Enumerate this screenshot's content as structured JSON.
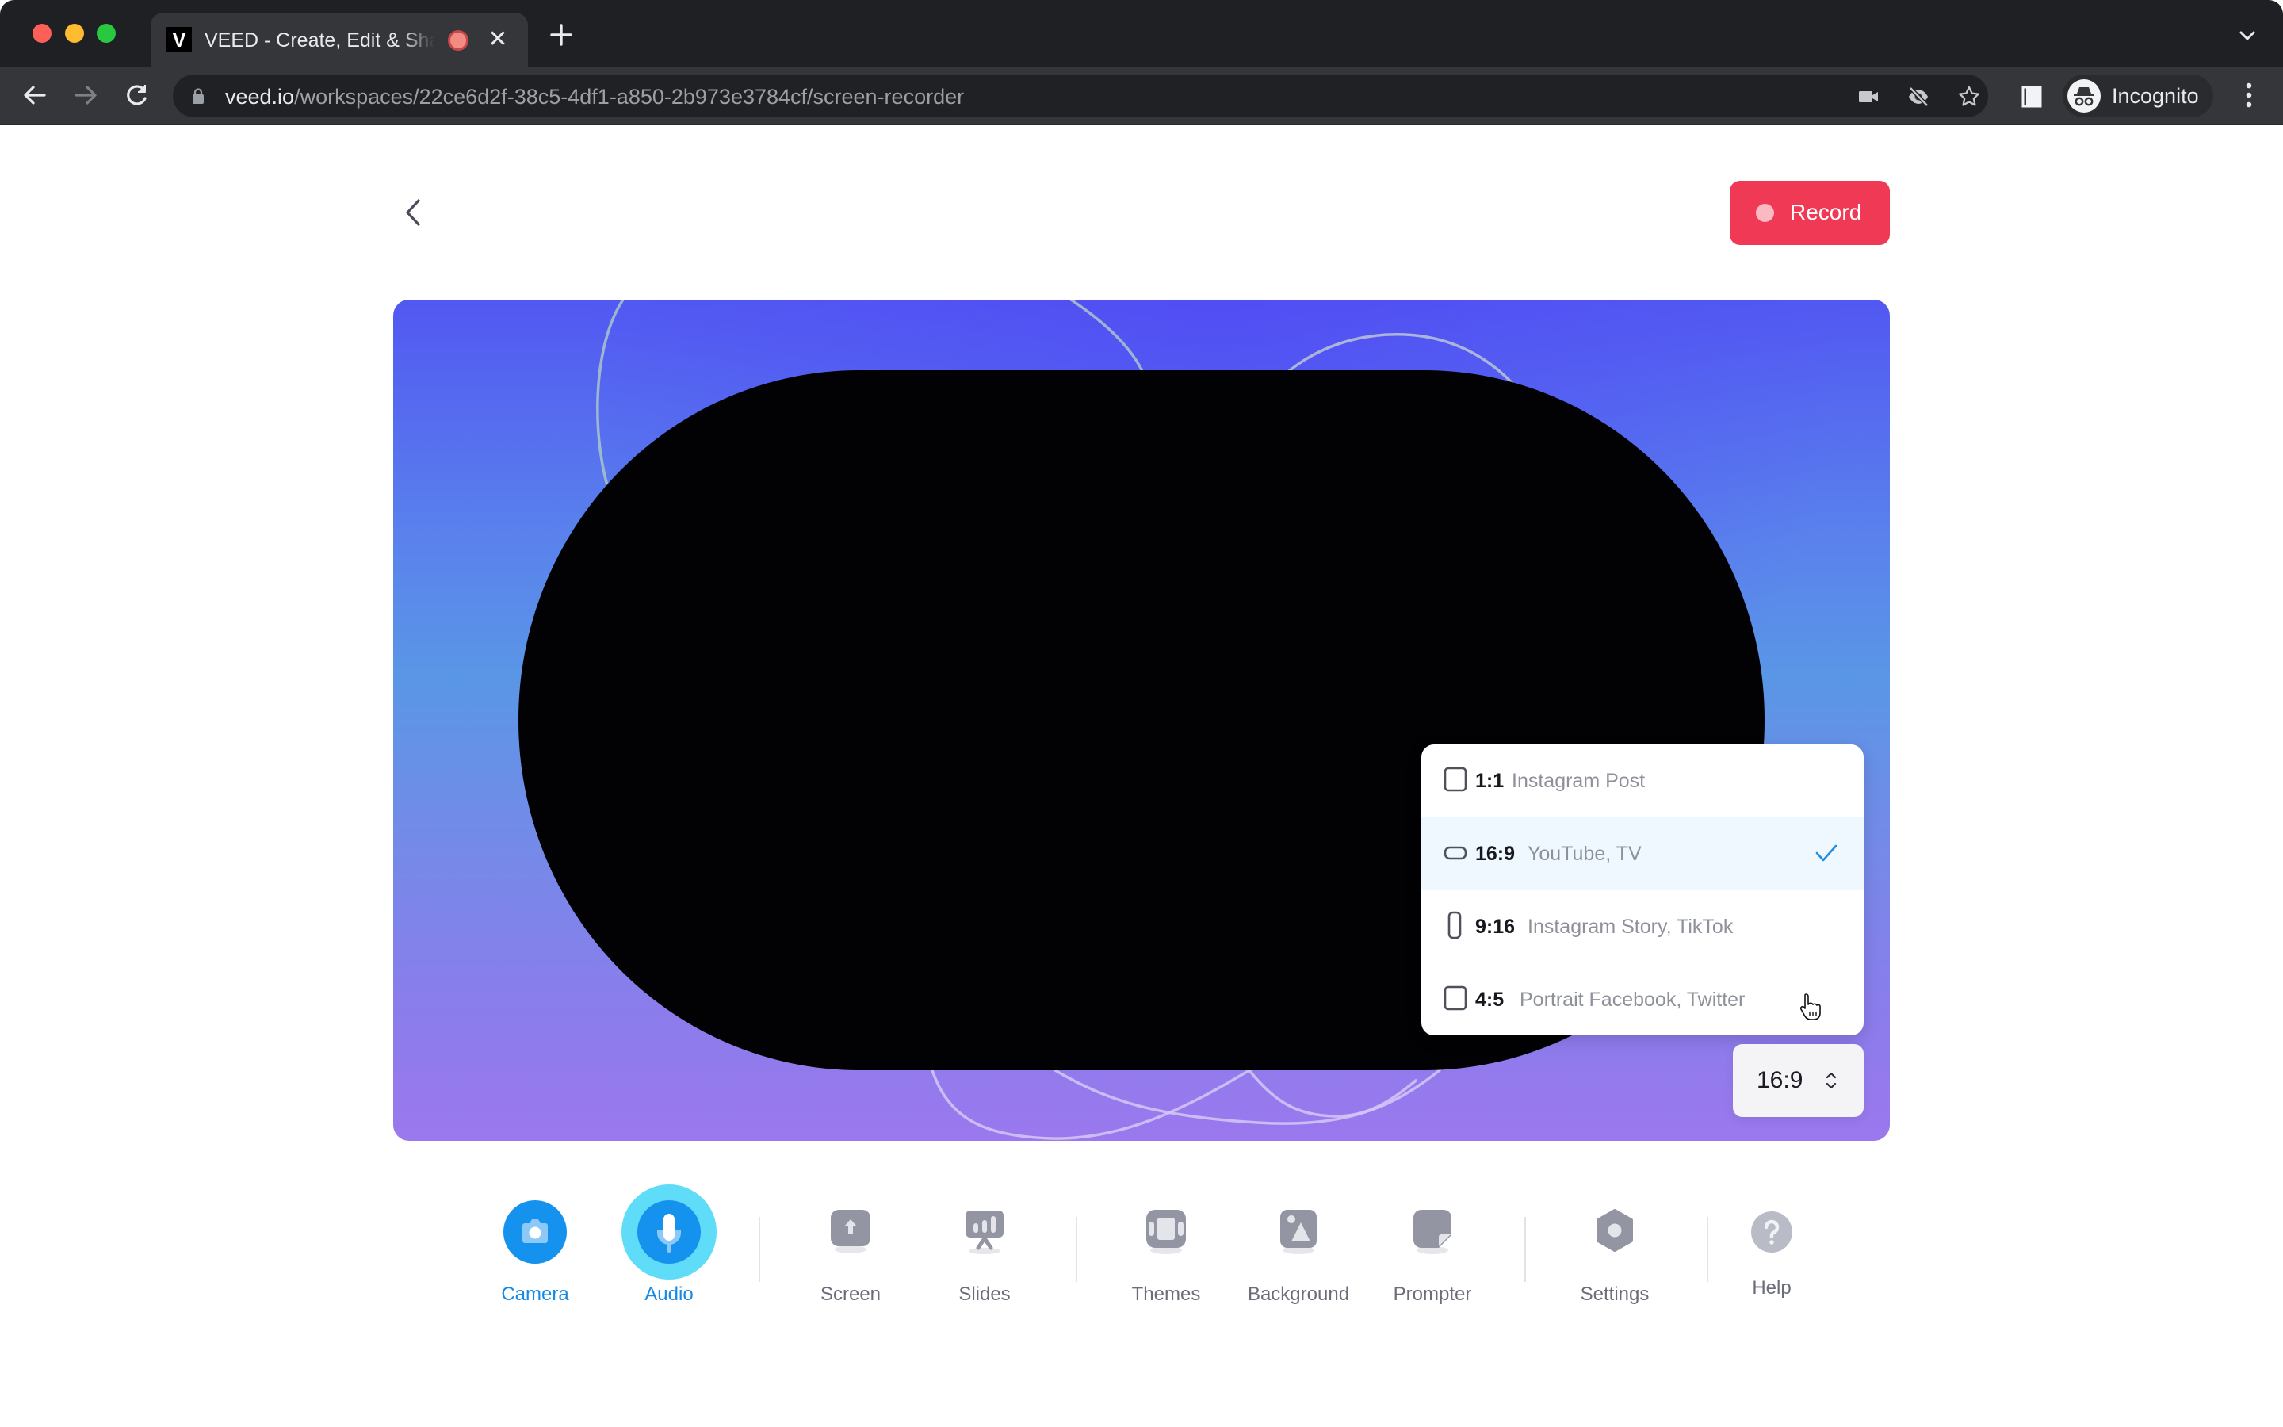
{
  "browser": {
    "tab": {
      "favicon_letter": "V",
      "title": "VEED - Create, Edit & Share Videos Online",
      "recording_indicator": "recording-icon",
      "close_icon": "close-icon"
    },
    "new_tab_icon": "plus-icon",
    "url": {
      "host": "veed.io",
      "path": "/workspaces/22ce6d2f-38c5-4df1-a850-2b973e3784cf/screen-recorder"
    },
    "omnibox_icons": [
      "camera-in-use-icon",
      "eye-off-icon",
      "star-icon"
    ],
    "profile_label": "Incognito",
    "colors": {
      "chrome_bg": "#1f2023",
      "tab_bg": "#35363a",
      "omnibox_bg": "#202124"
    }
  },
  "page": {
    "record_button": {
      "label": "Record",
      "color": "#f03a55"
    },
    "aspect_selector": {
      "current": "16:9",
      "options": [
        {
          "ratio": "1:1",
          "description": "Instagram Post",
          "icon": "square-icon",
          "selected": false
        },
        {
          "ratio": "16:9",
          "description": "YouTube, TV",
          "icon": "landscape-icon",
          "selected": true
        },
        {
          "ratio": "9:16",
          "description": "Instagram Story, TikTok",
          "icon": "portrait-icon",
          "selected": false
        },
        {
          "ratio": "4:5",
          "description": "Portrait Facebook, Twitter",
          "icon": "square-icon",
          "selected": false
        }
      ]
    },
    "toolbar": [
      {
        "id": "camera",
        "label": "Camera",
        "icon": "camera-icon",
        "active": true
      },
      {
        "id": "audio",
        "label": "Audio",
        "icon": "microphone-icon",
        "active": true
      },
      {
        "id": "screen",
        "label": "Screen",
        "icon": "screen-share-icon",
        "active": false
      },
      {
        "id": "slides",
        "label": "Slides",
        "icon": "slides-icon",
        "active": false
      },
      {
        "id": "themes",
        "label": "Themes",
        "icon": "themes-icon",
        "active": false
      },
      {
        "id": "background",
        "label": "Background",
        "icon": "background-icon",
        "active": false
      },
      {
        "id": "prompter",
        "label": "Prompter",
        "icon": "prompter-icon",
        "active": false
      },
      {
        "id": "settings",
        "label": "Settings",
        "icon": "settings-icon",
        "active": false
      },
      {
        "id": "help",
        "label": "Help",
        "icon": "help-icon",
        "active": false
      }
    ],
    "colors": {
      "accent": "#1589e6",
      "accent_ring": "#5ddcf6",
      "inactive_icon": "#9395a3",
      "selected_row": "#eef8fe"
    }
  }
}
